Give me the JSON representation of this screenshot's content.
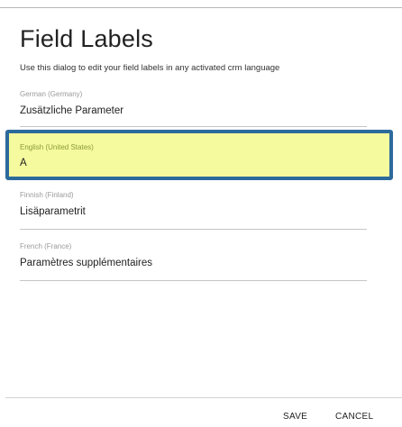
{
  "dialog": {
    "title": "Field Labels",
    "subtitle": "Use this dialog to edit your field labels in any activated crm language"
  },
  "fields": [
    {
      "language": "German (Germany)",
      "value": "Zusätzliche Parameter"
    },
    {
      "language": "English (United States)",
      "value": "A"
    },
    {
      "language": "Finnish (Finland)",
      "value": "Lisäparametrit"
    },
    {
      "language": "French (France)",
      "value": "Paramètres supplémentaires"
    }
  ],
  "actions": {
    "save_label": "SAVE",
    "cancel_label": "CANCEL"
  },
  "colors": {
    "highlight_fill": "#f5fa9e",
    "highlight_border": "#2d6a9c"
  }
}
